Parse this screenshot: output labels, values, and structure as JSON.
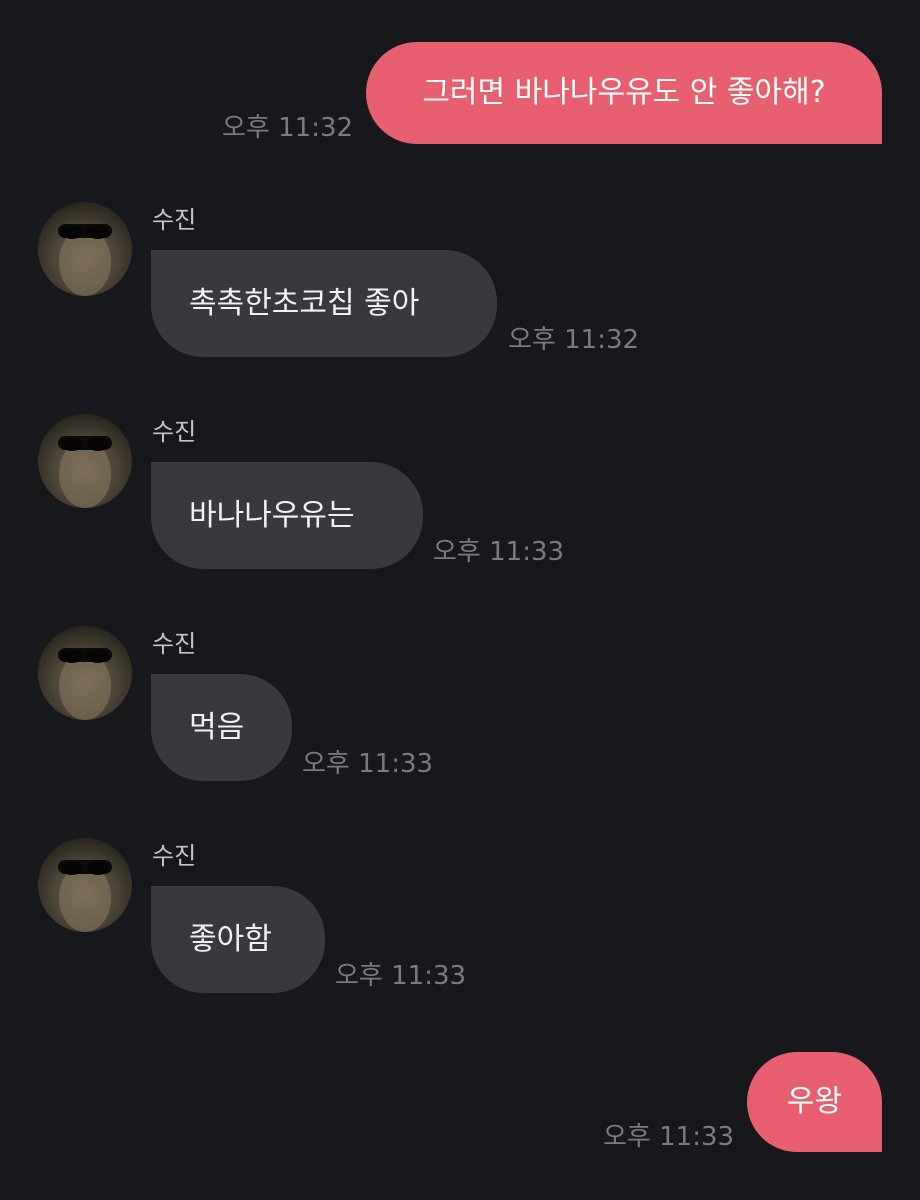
{
  "messages": [
    {
      "direction": "outgoing",
      "text": "그러면 바나나우유도 안 좋아해?",
      "time": "오후 11:32"
    },
    {
      "direction": "incoming",
      "sender": "수진",
      "text": "촉촉한초코칩 좋아",
      "time": "오후 11:32"
    },
    {
      "direction": "incoming",
      "sender": "수진",
      "text": "바나나우유는",
      "time": "오후 11:33"
    },
    {
      "direction": "incoming",
      "sender": "수진",
      "text": "먹음",
      "time": "오후 11:33"
    },
    {
      "direction": "incoming",
      "sender": "수진",
      "text": "좋아함",
      "time": "오후 11:33"
    },
    {
      "direction": "outgoing",
      "text": "우왕",
      "time": "오후 11:33"
    }
  ],
  "colors": {
    "background": "#17181c",
    "outgoing_bubble": "#e8606f",
    "incoming_bubble": "#38393e",
    "timestamp": "#7a7b80",
    "sender_name": "#c4c5c9"
  }
}
